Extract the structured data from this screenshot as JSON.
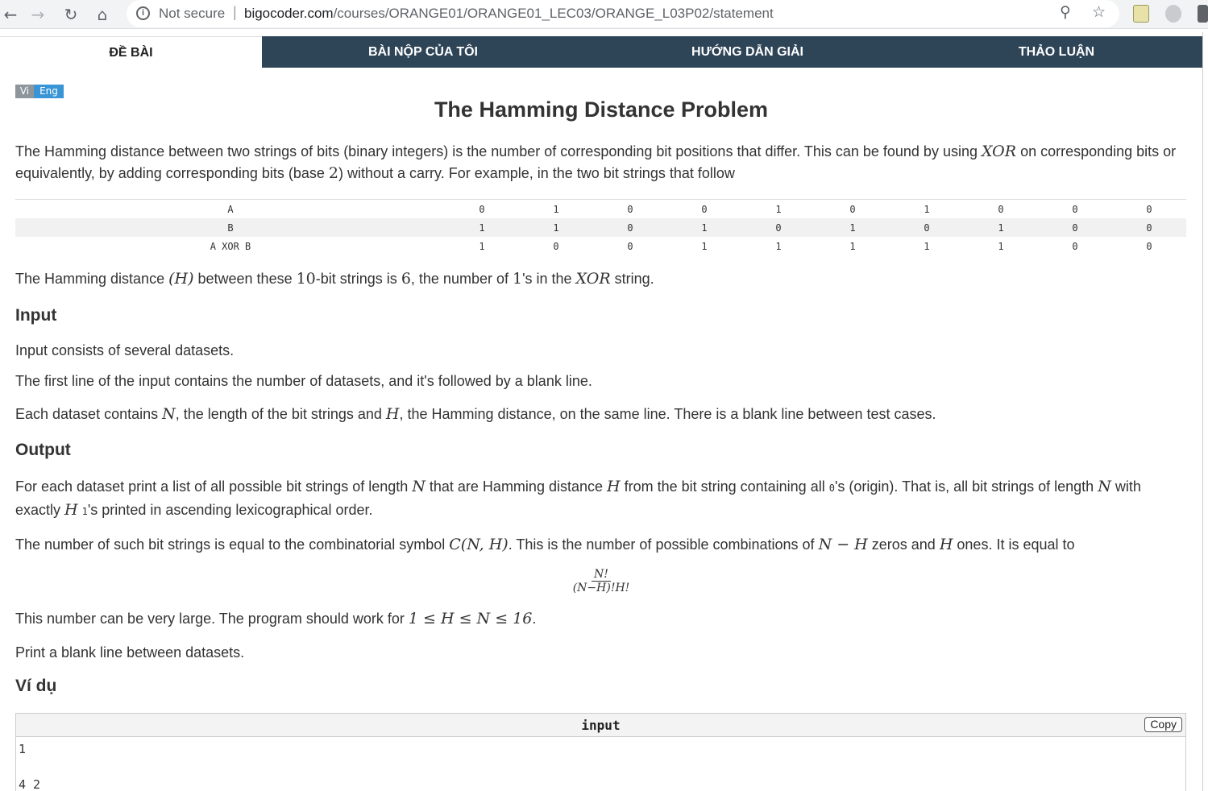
{
  "browser": {
    "security_label": "Not secure",
    "url_host": "bigocoder.com",
    "url_path": "/courses/ORANGE01/ORANGE01_LEC03/ORANGE_L03P02/statement"
  },
  "tabs": [
    {
      "label": "ĐỀ BÀI",
      "active": true
    },
    {
      "label": "BÀI NỘP CỦA TÔI",
      "active": false
    },
    {
      "label": "HƯỚNG DẪN GIẢI",
      "active": false
    },
    {
      "label": "THẢO LUẬN",
      "active": false
    }
  ],
  "lang": {
    "vi": "Vi",
    "en": "Eng"
  },
  "problem": {
    "title": "The Hamming Distance Problem",
    "intro_1": "The Hamming distance between two strings of bits (binary integers) is the number of corresponding bit positions that differ. This can be found by using ",
    "intro_xor": "XOR",
    "intro_2": " on corresponding bits or equivalently, by adding corresponding bits (base ",
    "intro_base": "2",
    "intro_3": ") without a carry. For example, in the two bit strings that follow",
    "bit_table": [
      {
        "label": "A",
        "bits": [
          "0",
          "1",
          "0",
          "0",
          "1",
          "0",
          "1",
          "0",
          "0",
          "0"
        ]
      },
      {
        "label": "B",
        "bits": [
          "1",
          "1",
          "0",
          "1",
          "0",
          "1",
          "0",
          "1",
          "0",
          "0"
        ]
      },
      {
        "label": "A XOR B",
        "bits": [
          "1",
          "0",
          "0",
          "1",
          "1",
          "1",
          "1",
          "1",
          "0",
          "0"
        ]
      }
    ],
    "hd_1": "The Hamming distance ",
    "hd_h": "(H)",
    "hd_2": " between these ",
    "hd_10": "10",
    "hd_3": "-bit strings is ",
    "hd_6": "6",
    "hd_4": ", the number of ",
    "hd_one": "1",
    "hd_5": "'s in the ",
    "hd_xor": "XOR",
    "hd_6t": " string.",
    "input_heading": "Input",
    "input_1": "Input consists of several datasets.",
    "input_2": "The first line of the input contains the number of datasets, and it's followed by a blank line.",
    "input_3a": "Each dataset contains ",
    "input_3n": "N",
    "input_3b": ", the length of the bit strings and ",
    "input_3h": "H",
    "input_3c": ", the Hamming distance, on the same line. There is a blank line between test cases.",
    "output_heading": "Output",
    "out_1a": "For each dataset print a list of all possible bit strings of length ",
    "out_1n": "N",
    "out_1b": " that are Hamming distance ",
    "out_1h": "H",
    "out_1c": " from the bit string containing all ",
    "out_1zero": "0",
    "out_1d": "'s (origin). That is, all bit strings of length ",
    "out_1n2": "N",
    "out_1e": " with exactly ",
    "out_1h2": "H",
    "out_1one": "1",
    "out_1f": "'s printed in ascending lexicographical order.",
    "out_2a": "The number of such bit strings is equal to the combinatorial symbol ",
    "out_2c": "C(N, H)",
    "out_2b": ". This is the number of possible combinations of ",
    "out_2nh": "N − H",
    "out_2d": " zeros and ",
    "out_2h": "H",
    "out_2e": " ones. It is equal to",
    "frac_num": "N!",
    "frac_den": "(N−H)!H!",
    "out_3a": "This number can be very large. The program should work for ",
    "out_3m": "1 ≤ H ≤ N ≤ 16",
    "out_3b": ".",
    "out_4": "Print a blank line between datasets.",
    "example_heading": "Ví dụ"
  },
  "example": {
    "header": "input",
    "copy_label": "Copy",
    "lines": [
      "1",
      "",
      "4 2"
    ]
  }
}
